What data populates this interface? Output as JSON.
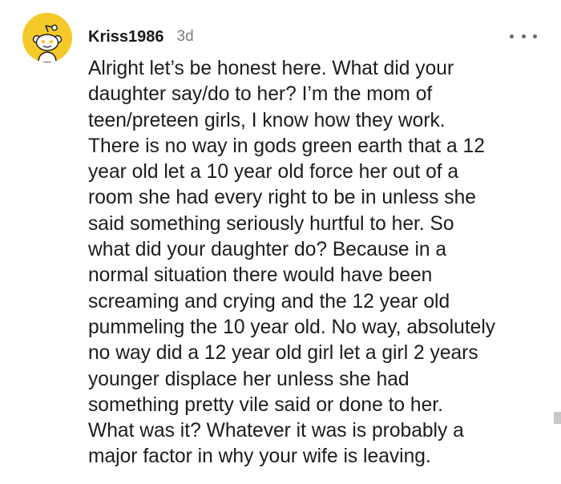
{
  "comment": {
    "username": "Kriss1986",
    "timestamp": "3d",
    "more_icon": "more-horizontal-icon",
    "avatar_icon": "reddit-snoo-avatar-icon",
    "avatar_color": "#f6c92a",
    "body": "Alright let’s be honest here. What did your\ndaughter say/do to her? I’m the mom of\nteen/preteen girls, I know how they work.\nThere is no way in gods green earth that a 12\nyear old let a 10 year old force her out of a\nroom she had every right to be in unless she\nsaid something seriously hurtful to her. So\nwhat did your daughter do? Because in a\nnormal situation there would have been\nscreaming and crying and the 12 year old\npummeling the 10 year old. No way, absolutely\nno way did a 12 year old girl let a girl 2 years\nyounger displace her unless she had\nsomething pretty vile said or done to her.\nWhat was it? Whatever it was is probably a\nmajor factor in why your wife is leaving."
  }
}
